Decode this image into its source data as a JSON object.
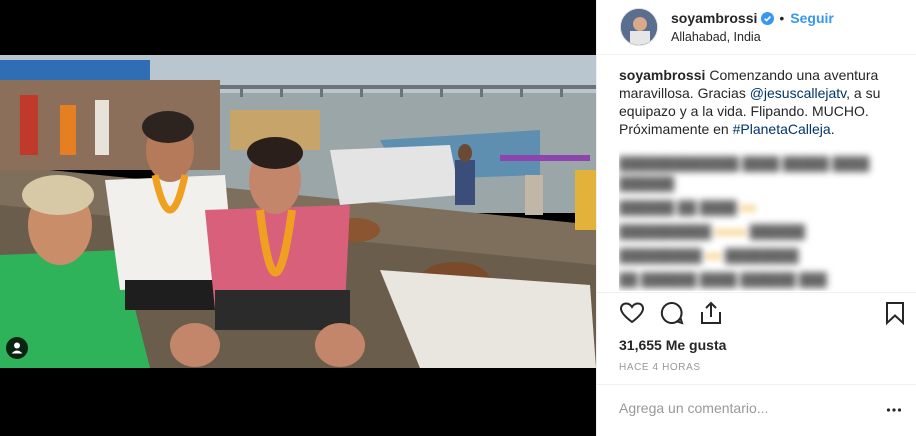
{
  "post": {
    "username": "soyambrossi",
    "follow_label": "Seguir",
    "location": "Allahabad, India",
    "caption_text": "Comenzando una aventura maravillosa. Gracias ",
    "caption_mention": "@jesuscallejatv",
    "caption_text2": ", a su equipazo y a la vida. Flipando. MUCHO. Próximamente en ",
    "caption_hashtag": "#PlanetaCalleja",
    "caption_end": ".",
    "likes": "31,655 Me gusta",
    "time_ago": "HACE 4 HORAS",
    "comment_placeholder": "Agrega un comentario..."
  },
  "colors": {
    "link": "#003569",
    "follow": "#3897f0",
    "verified": "#3897f0"
  },
  "icons": [
    "verified-icon",
    "heart-icon",
    "comment-icon",
    "share-icon",
    "bookmark-icon",
    "more-icon",
    "user-tag-icon"
  ]
}
